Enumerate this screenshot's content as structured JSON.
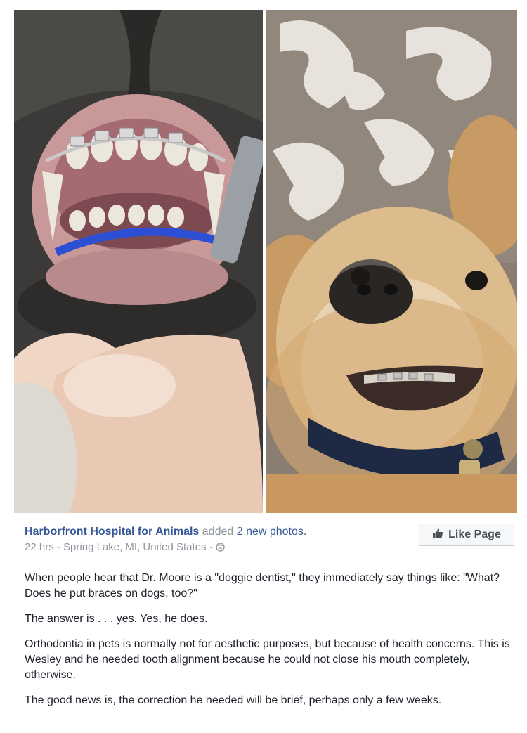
{
  "post": {
    "page_name": "Harborfront Hospital for Animals",
    "added_text": "added",
    "photos_link": "2 new photos.",
    "time": "22 hrs",
    "separator": "·",
    "location": "Spring Lake, MI, United States",
    "like_button": "Like Page",
    "icons": {
      "globe": "globe-icon",
      "like": "thumbs-up-icon"
    },
    "paragraphs": [
      "When people hear that Dr. Moore is a \"doggie dentist,\" they immediately say things like: \"What? Does he put braces on dogs, too?\"",
      "The answer is . . . yes. Yes, he does.",
      "Orthodontia in pets is normally not for aesthetic purposes, but because of health concerns. This is Wesley and he needed tooth alignment because he could not close his mouth completely, otherwise.",
      "The good news is, the correction he needed will be brief, perhaps only a few weeks."
    ]
  },
  "colors": {
    "link": "#365899",
    "meta": "#90949c",
    "text": "#1d2129"
  }
}
